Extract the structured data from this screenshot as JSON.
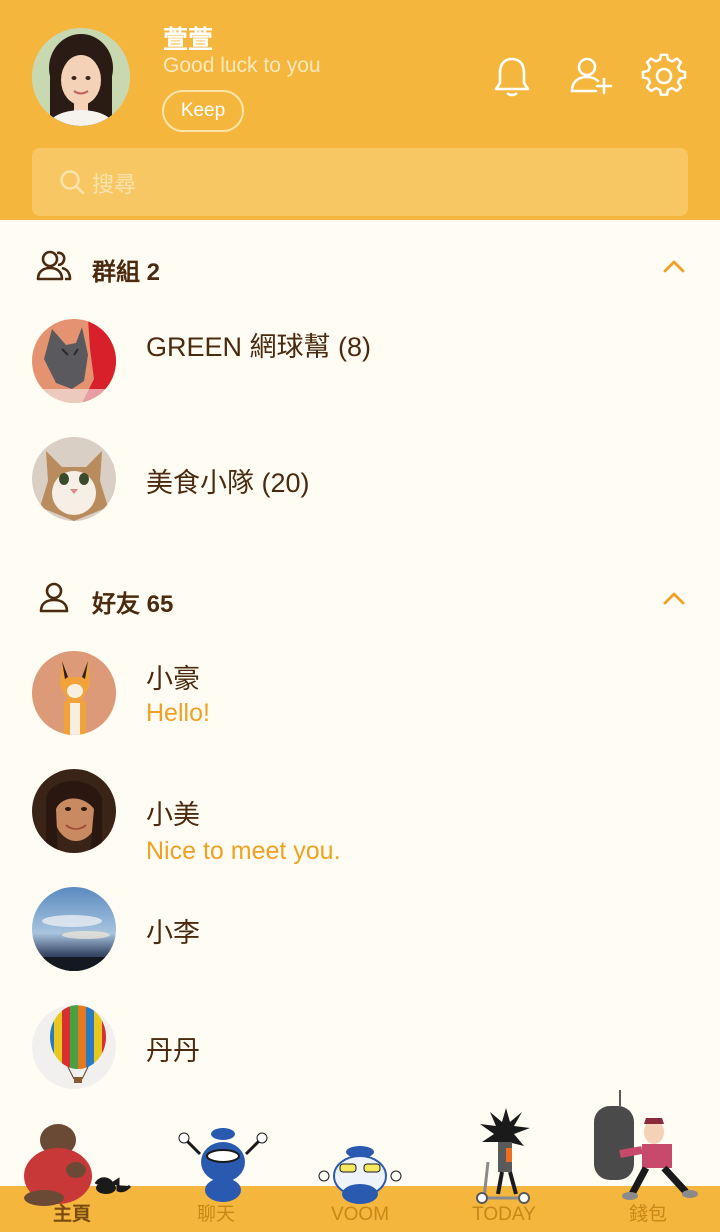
{
  "profile": {
    "name": "萱萱",
    "status": "Good luck to you",
    "keep_label": "Keep"
  },
  "header_icons": [
    "bell-icon",
    "add-friend-icon",
    "settings-icon"
  ],
  "search": {
    "placeholder": "搜尋"
  },
  "groups": {
    "title": "群組 2",
    "items": [
      {
        "name": "GREEN 網球幫 (8)"
      },
      {
        "name": "美食小隊 (20)"
      }
    ]
  },
  "friends": {
    "title": "好友 65",
    "items": [
      {
        "name": "小豪",
        "message": "Hello!"
      },
      {
        "name": "小美",
        "message": "Nice to meet you."
      },
      {
        "name": "小李"
      },
      {
        "name": "丹丹"
      }
    ]
  },
  "nav": {
    "items": [
      {
        "label": "主頁",
        "active": true
      },
      {
        "label": "聊天"
      },
      {
        "label": "VOOM"
      },
      {
        "label": "TODAY"
      },
      {
        "label": "錢包"
      }
    ]
  },
  "colors": {
    "header_bg": "#f5b63d",
    "page_bg": "#fffdf3",
    "text_dark": "#4a2a10",
    "accent": "#f0a125"
  }
}
